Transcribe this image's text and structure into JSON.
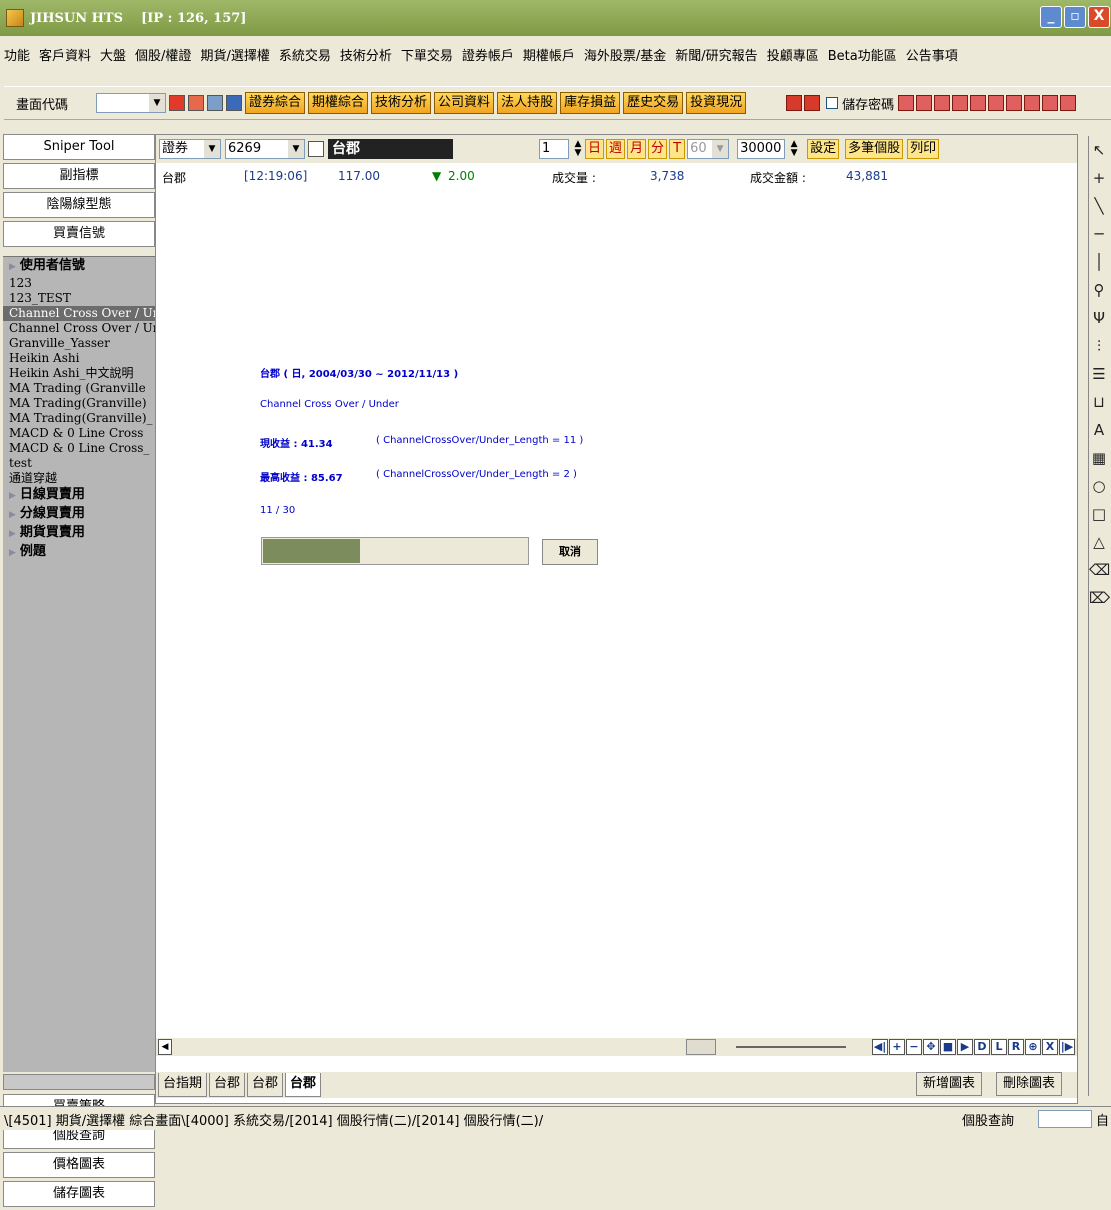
{
  "window": {
    "title": "JIHSUN HTS    [IP : 126, 157]"
  },
  "menu": [
    "功能",
    "客戶資料",
    "大盤",
    "個股/權證",
    "期貨/選擇權",
    "系統交易",
    "技術分析",
    "下單交易",
    "證券帳戶",
    "期權帳戶",
    "海外股票/基金",
    "新聞/研究報告",
    "投顧專區",
    "Beta功能區",
    "公告事項"
  ],
  "toolbar": {
    "code_label": "畫面代碼",
    "buttons": [
      "證券綜合",
      "期權綜合",
      "技術分析",
      "公司資料",
      "法人持股",
      "庫存損益",
      "歷史交易",
      "投資現況"
    ],
    "save_password": "儲存密碼"
  },
  "left_panel": {
    "top_buttons": [
      "Sniper Tool",
      "副指標",
      "陰陽線型態",
      "買賣信號"
    ],
    "tree": [
      {
        "label": "使用者信號",
        "folder": true
      },
      {
        "label": "123"
      },
      {
        "label": "123_TEST"
      },
      {
        "label": "Channel Cross Over / Ur",
        "selected": true
      },
      {
        "label": "Channel Cross Over / Ur"
      },
      {
        "label": "Granville_Yasser"
      },
      {
        "label": "Heikin Ashi"
      },
      {
        "label": "Heikin Ashi_中文說明"
      },
      {
        "label": "MA Trading (Granville"
      },
      {
        "label": "MA Trading(Granville)"
      },
      {
        "label": "MA Trading(Granville)_"
      },
      {
        "label": "MACD & 0 Line Cross"
      },
      {
        "label": "MACD & 0 Line Cross_"
      },
      {
        "label": "test"
      },
      {
        "label": "通道穿越"
      },
      {
        "label": "日線買賣用",
        "folder": true
      },
      {
        "label": "分線買賣用",
        "folder": true
      },
      {
        "label": "期貨買賣用",
        "folder": true
      },
      {
        "label": "例題",
        "folder": true
      }
    ],
    "bottom_buttons": [
      "買賣策略",
      "個股查詢",
      "價格圖表",
      "儲存圖表"
    ]
  },
  "query": {
    "market": "證券",
    "code": "6269",
    "stock_name": "台郡",
    "count": "1",
    "periods": [
      "日",
      "週",
      "月",
      "分",
      "T"
    ],
    "minutes": "60",
    "bars": "30000",
    "settings_label": "設定",
    "multi_label": "多筆個股",
    "print_label": "列印"
  },
  "quote": {
    "name": "台郡",
    "time": "[12:19:06]",
    "price": "117.00",
    "change": "2.00",
    "volume_label": "成交量 :",
    "volume": "3,738",
    "amount_label": "成交金額 :",
    "amount": "43,881"
  },
  "status": {
    "line1": "台郡 ( 日, 2004/03/30 ~ 2012/11/13 )",
    "line2": "Channel Cross Over / Under",
    "line3_label": "現收益 : 41.34",
    "line3_param": "( ChannelCrossOver/Under_Length = 11 )",
    "line4_label": "最高收益 : 85.67",
    "line4_param": "( ChannelCrossOver/Under_Length = 2 )",
    "progress_text": "11 / 30",
    "progress": 0.3667,
    "cancel_label": "取消"
  },
  "nav_buttons": [
    "◀|",
    "+",
    "−",
    "✥",
    "■",
    "▶",
    "D",
    "L",
    "R",
    "⊕",
    "X",
    "|▶"
  ],
  "chart_tabs": [
    {
      "label": "台指期"
    },
    {
      "label": "台郡"
    },
    {
      "label": "台郡"
    },
    {
      "label": "台郡",
      "active": true
    }
  ],
  "chart_actions": {
    "add": "新增圖表",
    "delete": "刪除圖表"
  },
  "right_tools": [
    "↖",
    "+",
    "╲",
    "─",
    "│",
    "⚲",
    "Ψ",
    "⫶",
    "☰",
    "⊔",
    "A",
    "▦",
    "○",
    "□",
    "△",
    "⌫",
    "⌦"
  ],
  "bottom": {
    "tabs": "\\[4501] 期貨/選擇權 綜合畫面\\[4000] 系統交易/[2014] 個股行情(二)/[2014] 個股行情(二)/",
    "query_label": "個股查詢",
    "after": "自"
  }
}
